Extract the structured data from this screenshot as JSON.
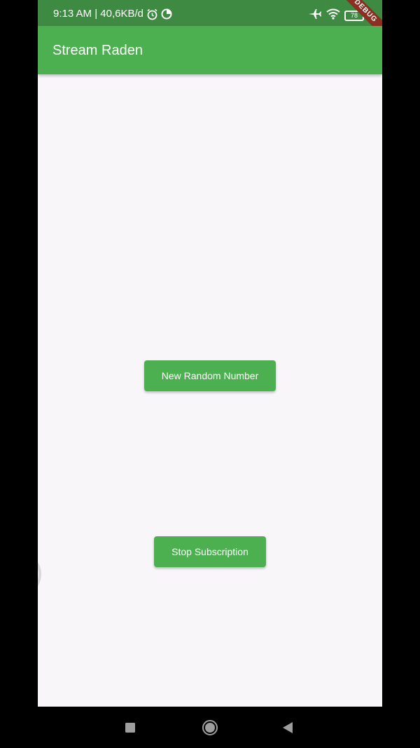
{
  "status_bar": {
    "time_speed": "9:13 AM | 40,6KB/d",
    "battery": "78",
    "background": "#3f8a43"
  },
  "debug_banner": "DEBUG",
  "app_bar": {
    "title": "Stream Raden",
    "background": "#4caf50"
  },
  "main": {
    "random_button_label": "New Random Number",
    "stop_button_label": "Stop Subscription",
    "background": "#f8f6f9"
  },
  "nav_bar": {
    "items": [
      "recents-icon",
      "home-icon",
      "back-icon"
    ]
  }
}
